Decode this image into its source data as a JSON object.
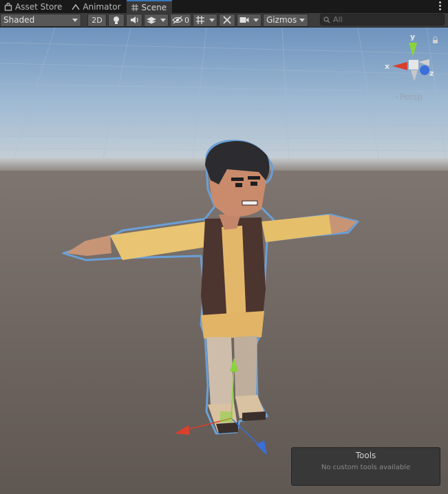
{
  "tabs": [
    {
      "label": "Asset Store",
      "icon": "shopping-bag-icon"
    },
    {
      "label": "Animator",
      "icon": "animator-icon"
    },
    {
      "label": "Scene",
      "icon": "grid-hash-icon"
    }
  ],
  "toolbar": {
    "draw_mode": "Shaded",
    "mode_2d": "2D",
    "hidden_count": "0",
    "gizmos": "Gizmos",
    "search_placeholder": "All"
  },
  "scene_gizmo": {
    "y_label": "y",
    "x_label": "x",
    "z_label": "z",
    "projection": "Persp"
  },
  "tools_overlay": {
    "title": "Tools",
    "subtitle": "No custom tools available"
  },
  "colors": {
    "selection_outline": "#6aa0d8",
    "axis_x": "#d8402c",
    "axis_y": "#8ad43a",
    "axis_z": "#3a6ed8",
    "active_tab_accent": "#3a79bb"
  }
}
